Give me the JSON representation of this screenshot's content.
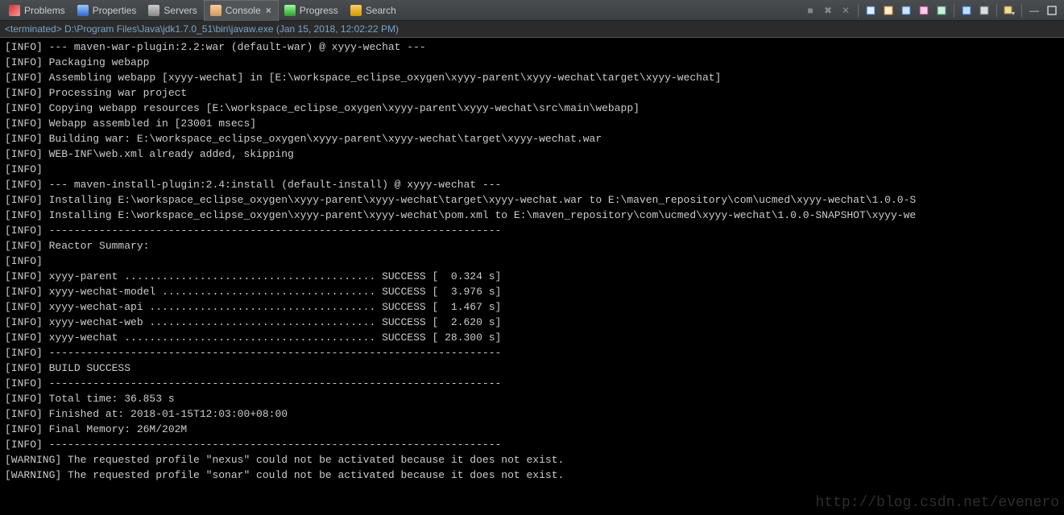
{
  "tabs": [
    {
      "label": "Problems"
    },
    {
      "label": "Properties"
    },
    {
      "label": "Servers"
    },
    {
      "label": "Console"
    },
    {
      "label": "Progress"
    },
    {
      "label": "Search"
    }
  ],
  "terminated": "<terminated> D:\\Program Files\\Java\\jdk1.7.0_51\\bin\\javaw.exe (Jan 15, 2018, 12:02:22 PM)",
  "console_lines": [
    "[INFO] --- maven-war-plugin:2.2:war (default-war) @ xyyy-wechat ---",
    "[INFO] Packaging webapp",
    "[INFO] Assembling webapp [xyyy-wechat] in [E:\\workspace_eclipse_oxygen\\xyyy-parent\\xyyy-wechat\\target\\xyyy-wechat]",
    "[INFO] Processing war project",
    "[INFO] Copying webapp resources [E:\\workspace_eclipse_oxygen\\xyyy-parent\\xyyy-wechat\\src\\main\\webapp]",
    "[INFO] Webapp assembled in [23001 msecs]",
    "[INFO] Building war: E:\\workspace_eclipse_oxygen\\xyyy-parent\\xyyy-wechat\\target\\xyyy-wechat.war",
    "[INFO] WEB-INF\\web.xml already added, skipping",
    "[INFO]",
    "[INFO] --- maven-install-plugin:2.4:install (default-install) @ xyyy-wechat ---",
    "[INFO] Installing E:\\workspace_eclipse_oxygen\\xyyy-parent\\xyyy-wechat\\target\\xyyy-wechat.war to E:\\maven_repository\\com\\ucmed\\xyyy-wechat\\1.0.0-S",
    "[INFO] Installing E:\\workspace_eclipse_oxygen\\xyyy-parent\\xyyy-wechat\\pom.xml to E:\\maven_repository\\com\\ucmed\\xyyy-wechat\\1.0.0-SNAPSHOT\\xyyy-we",
    "[INFO] ------------------------------------------------------------------------",
    "[INFO] Reactor Summary:",
    "[INFO]",
    "[INFO] xyyy-parent ........................................ SUCCESS [  0.324 s]",
    "[INFO] xyyy-wechat-model .................................. SUCCESS [  3.976 s]",
    "[INFO] xyyy-wechat-api .................................... SUCCESS [  1.467 s]",
    "[INFO] xyyy-wechat-web .................................... SUCCESS [  2.620 s]",
    "[INFO] xyyy-wechat ........................................ SUCCESS [ 28.300 s]",
    "[INFO] ------------------------------------------------------------------------",
    "[INFO] BUILD SUCCESS",
    "[INFO] ------------------------------------------------------------------------",
    "[INFO] Total time: 36.853 s",
    "[INFO] Finished at: 2018-01-15T12:03:00+08:00",
    "[INFO] Final Memory: 26M/202M",
    "[INFO] ------------------------------------------------------------------------",
    "[WARNING] The requested profile \"nexus\" could not be activated because it does not exist.",
    "[WARNING] The requested profile \"sonar\" could not be activated because it does not exist."
  ],
  "watermark": "http://blog.csdn.net/evenero",
  "toolbar_icons": [
    "terminate-icon",
    "terminate-all-icon",
    "remove-launch-icon",
    "sep",
    "clear-console-icon",
    "scroll-lock-icon",
    "pin-console-icon",
    "display-selected-icon",
    "open-console-icon",
    "sep",
    "new-console-icon",
    "show-console-icon",
    "sep",
    "dropdown-icon",
    "sep",
    "minimize-icon",
    "maximize-icon"
  ]
}
